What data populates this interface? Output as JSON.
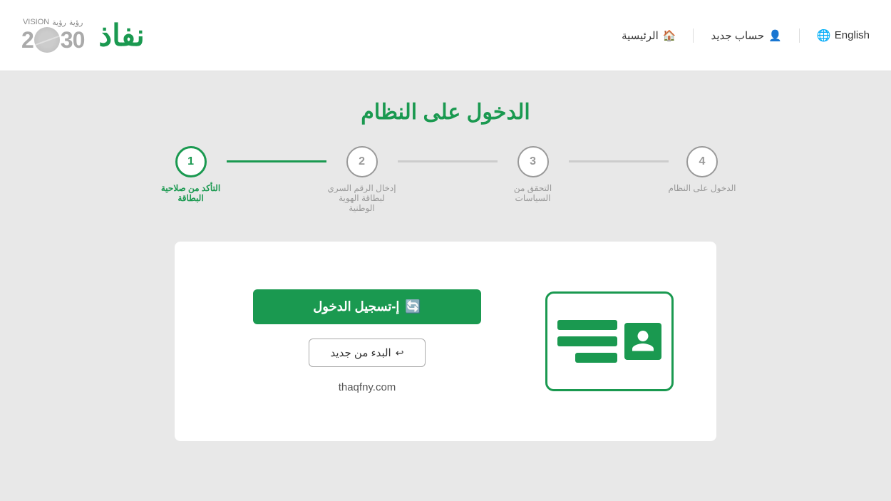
{
  "header": {
    "logo_text": "نفاذ",
    "vision_label": "رؤية",
    "vision_year": "2030",
    "nav": {
      "home_label": "الرئيسية",
      "new_account_label": "حساب جديد",
      "language_label": "English"
    }
  },
  "main": {
    "page_title": "الدخول على النظام",
    "steps": [
      {
        "number": "1",
        "label": "التأكد من صلاحية البطاقة",
        "active": true
      },
      {
        "number": "2",
        "label": "إدخال الرقم السري لبطاقة الهوية الوطنية",
        "active": false
      },
      {
        "number": "3",
        "label": "التحقق من السياسات",
        "active": false
      },
      {
        "number": "4",
        "label": "الدخول على النظام",
        "active": false
      }
    ],
    "card": {
      "login_button_label": "إ-تسجيل الدخول",
      "new_start_button_label": "البدء من جديد",
      "website": "thaqfny.com"
    }
  }
}
